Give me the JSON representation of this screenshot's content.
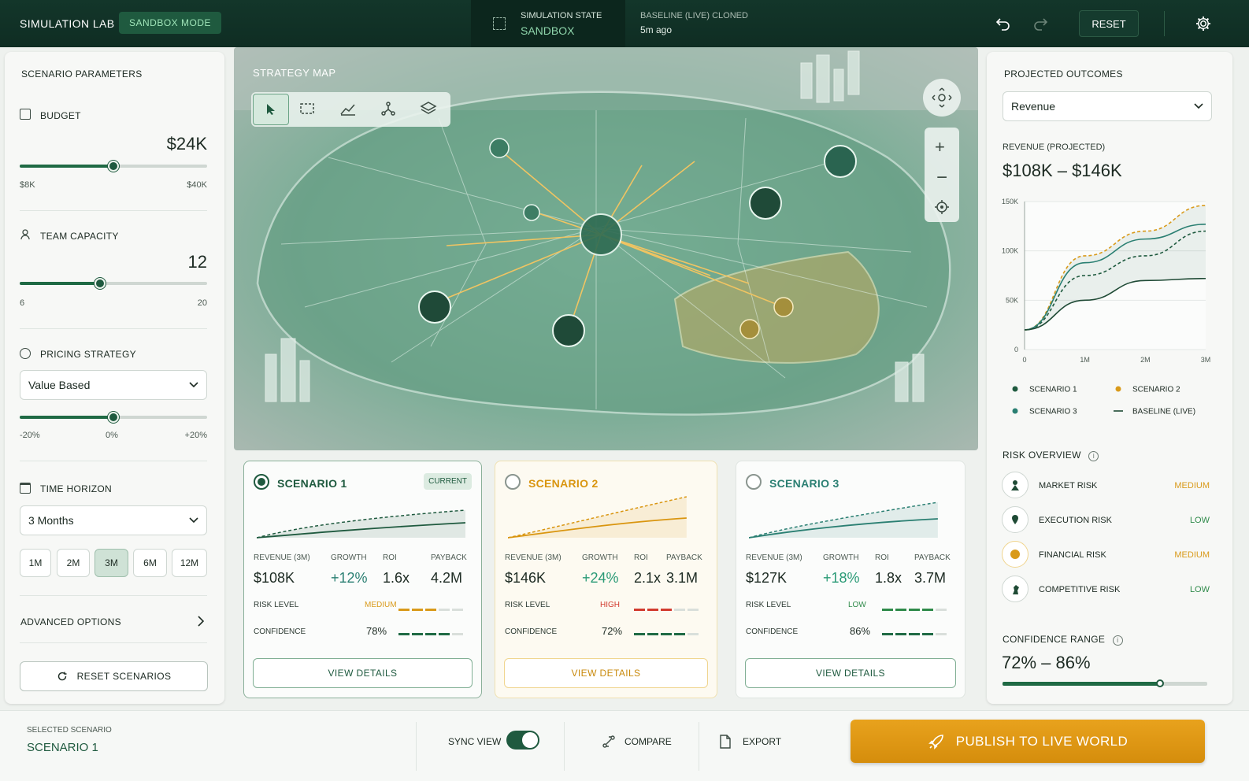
{
  "header": {
    "app_title": "SIMULATION LAB",
    "mode_badge": "SANDBOX MODE",
    "state_label": "SIMULATION STATE",
    "state_value": "SANDBOX",
    "baseline_label": "BASELINE (LIVE) CLONED",
    "baseline_time": "5m ago",
    "reset_label": "RESET"
  },
  "params": {
    "title": "SCENARIO PARAMETERS",
    "budget": {
      "label": "BUDGET",
      "value": "$24K",
      "min": "$8K",
      "max": "$40K",
      "level": 0.5
    },
    "team": {
      "label": "TEAM CAPACITY",
      "value": "12",
      "min": "6",
      "max": "20",
      "level": 0.43
    },
    "pricing": {
      "label": "PRICING STRATEGY",
      "selected": "Value Based",
      "min": "-20%",
      "mid": "0%",
      "max": "+20%",
      "level": 0.5
    },
    "horizon": {
      "label": "TIME HORIZON",
      "selected": "3 Months",
      "options": [
        "1M",
        "2M",
        "3M",
        "6M",
        "12M"
      ],
      "active": "3M"
    },
    "advanced": "ADVANCED OPTIONS",
    "reset_scenarios": "RESET SCENARIOS"
  },
  "map": {
    "title": "STRATEGY MAP",
    "tools": [
      "select-tool",
      "marquee-tool",
      "chart-tool",
      "network-tool",
      "layers-tool"
    ]
  },
  "scenarios": [
    {
      "name": "SCENARIO 1",
      "badge": "CURRENT",
      "color": "#1f5a3f",
      "rev_h": "REVENUE (3M)",
      "rev": "$108K",
      "growth_h": "GROWTH",
      "growth": "+12%",
      "roi_h": "ROI",
      "roi": "1.6x",
      "payback_h": "PAYBACK",
      "payback": "4.2M",
      "risk_h": "RISK LEVEL",
      "risk": "MEDIUM",
      "risk_color": "#d99a1a",
      "risk_level": 3,
      "conf_h": "CONFIDENCE",
      "conf": "78%",
      "conf_level": 0.78,
      "details": "VIEW DETAILS"
    },
    {
      "name": "SCENARIO 2",
      "badge": "",
      "color": "#d9950f",
      "rev_h": "REVENUE (3M)",
      "rev": "$146K",
      "growth_h": "GROWTH",
      "growth": "+24%",
      "roi_h": "ROI",
      "roi": "2.1x",
      "payback_h": "PAYBACK",
      "payback": "3.1M",
      "risk_h": "RISK LEVEL",
      "risk": "HIGH",
      "risk_color": "#d23b2e",
      "risk_level": 3,
      "conf_h": "CONFIDENCE",
      "conf": "72%",
      "conf_level": 0.72,
      "details": "VIEW DETAILS"
    },
    {
      "name": "SCENARIO 3",
      "badge": "",
      "color": "#2a7f72",
      "rev_h": "REVENUE (3M)",
      "rev": "$127K",
      "growth_h": "GROWTH",
      "growth": "+18%",
      "roi_h": "ROI",
      "roi": "1.8x",
      "payback_h": "PAYBACK",
      "payback": "3.7M",
      "risk_h": "RISK LEVEL",
      "risk": "LOW",
      "risk_color": "#2f8a4a",
      "risk_level": 4,
      "conf_h": "CONFIDENCE",
      "conf": "86%",
      "conf_level": 0.86,
      "details": "VIEW DETAILS"
    }
  ],
  "outcomes": {
    "title": "PROJECTED OUTCOMES",
    "metric_selected": "Revenue",
    "revenue_label": "REVENUE (PROJECTED)",
    "revenue_range": "$108K – $146K",
    "risk_title": "RISK OVERVIEW",
    "risks": [
      {
        "name": "MARKET RISK",
        "level": "MEDIUM",
        "color": "#d99a1a",
        "icon": "person-icon"
      },
      {
        "name": "EXECUTION RISK",
        "level": "LOW",
        "color": "#2f8a4a",
        "icon": "pin-icon"
      },
      {
        "name": "FINANCIAL RISK",
        "level": "MEDIUM",
        "color": "#d99a1a",
        "icon": "coin-icon"
      },
      {
        "name": "COMPETITIVE RISK",
        "level": "LOW",
        "color": "#2f8a4a",
        "icon": "chess-icon"
      }
    ],
    "confidence_title": "CONFIDENCE RANGE",
    "confidence_range": "72% – 86%",
    "confidence_level": 0.77
  },
  "chart_data": {
    "type": "line",
    "x": [
      0,
      1,
      2,
      3
    ],
    "x_tick_labels": [
      "0",
      "1M",
      "2M",
      "3M"
    ],
    "y_tick_labels": [
      "0",
      "50K",
      "100K",
      "150K"
    ],
    "ylim": [
      0,
      150
    ],
    "series": [
      {
        "name": "SCENARIO 1",
        "color": "#1f5a3f",
        "dash": true,
        "values": [
          20,
          75,
          95,
          120
        ]
      },
      {
        "name": "SCENARIO 2",
        "color": "#d99a1a",
        "dash": true,
        "values": [
          20,
          95,
          120,
          146
        ]
      },
      {
        "name": "SCENARIO 3",
        "color": "#2a7f72",
        "dash": false,
        "values": [
          20,
          88,
          112,
          127
        ]
      },
      {
        "name": "BASELINE (LIVE)",
        "color": "#1f4a35",
        "dash": false,
        "values": [
          20,
          50,
          70,
          72
        ]
      }
    ],
    "legend": "bottom"
  },
  "footer": {
    "selected_label": "SELECTED SCENARIO",
    "selected_value": "SCENARIO 1",
    "sync_label": "SYNC VIEW",
    "compare": "COMPARE",
    "export": "EXPORT",
    "publish": "PUBLISH TO LIVE WORLD"
  }
}
